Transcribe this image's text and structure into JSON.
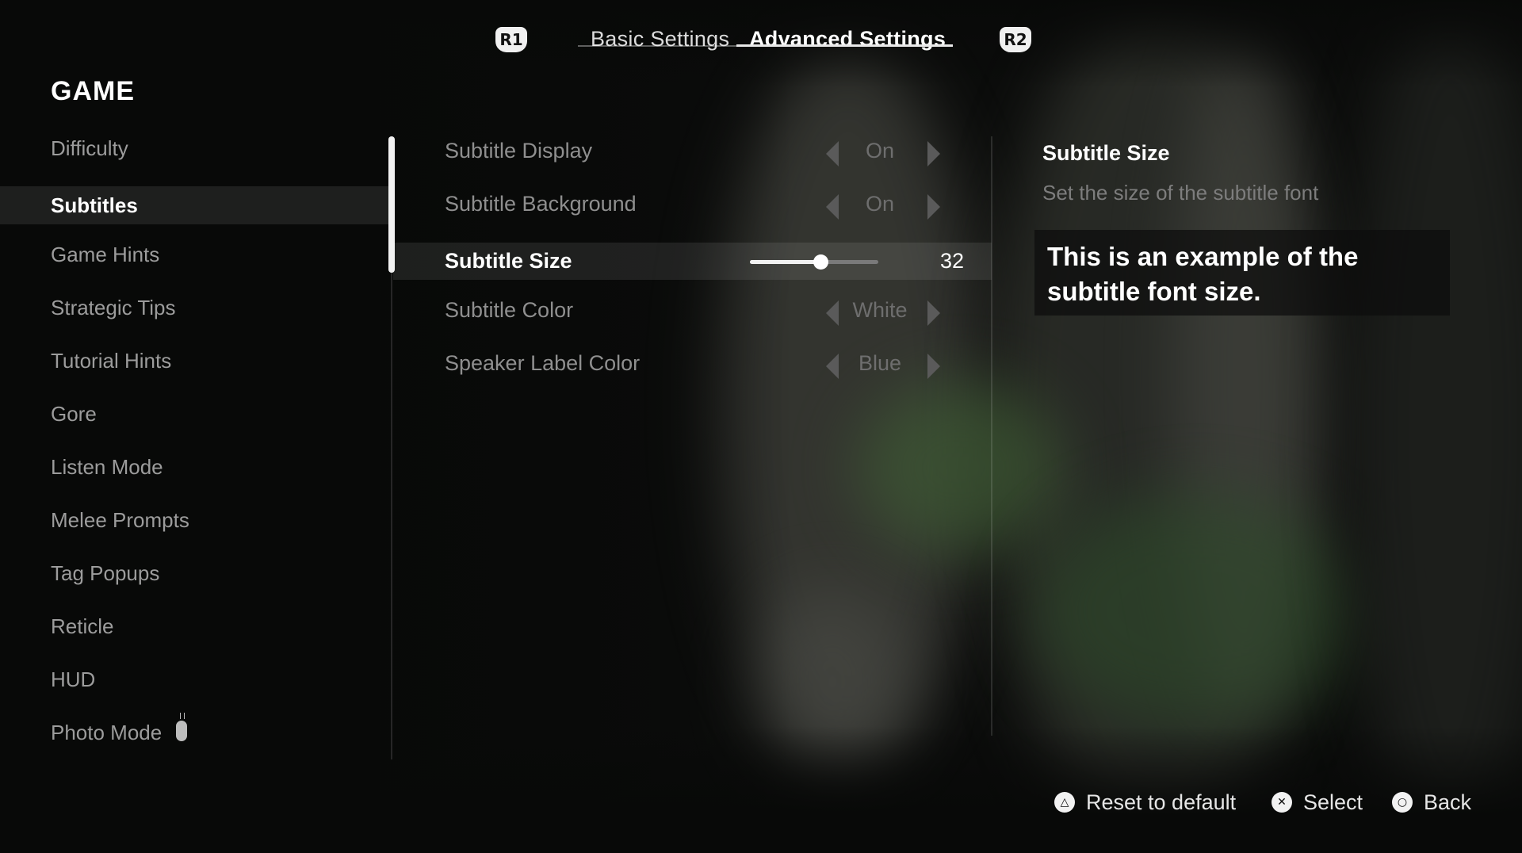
{
  "header": {
    "left_bumper": "R1",
    "right_bumper": "R2",
    "tabs": [
      {
        "label": "Basic Settings",
        "active": false
      },
      {
        "label": "Advanced Settings",
        "active": true
      }
    ]
  },
  "sidebar": {
    "section_title": "GAME",
    "items": [
      {
        "label": "Difficulty"
      },
      {
        "label": "Subtitles",
        "selected": true
      },
      {
        "label": "Game Hints"
      },
      {
        "label": "Strategic Tips"
      },
      {
        "label": "Tutorial Hints"
      },
      {
        "label": "Gore"
      },
      {
        "label": "Listen Mode"
      },
      {
        "label": "Melee Prompts"
      },
      {
        "label": "Tag Popups"
      },
      {
        "label": "Reticle"
      },
      {
        "label": "HUD"
      },
      {
        "label": "Photo Mode",
        "icon": "controller-icon"
      }
    ]
  },
  "settings": [
    {
      "label": "Subtitle Display",
      "type": "selector",
      "value": "On"
    },
    {
      "label": "Subtitle Background",
      "type": "selector",
      "value": "On"
    },
    {
      "label": "Subtitle Size",
      "type": "slider",
      "value": "32",
      "slider_fraction": 0.55,
      "active": true
    },
    {
      "label": "Subtitle Color",
      "type": "selector",
      "value": "White"
    },
    {
      "label": "Speaker Label Color",
      "type": "selector",
      "value": "Blue"
    }
  ],
  "description": {
    "title": "Subtitle Size",
    "text": "Set the size of the subtitle font",
    "preview": "This is an example of the subtitle font size."
  },
  "footer": {
    "prompts": [
      {
        "icon": "triangle-button-icon",
        "glyph": "△",
        "label": "Reset to default"
      },
      {
        "icon": "cross-button-icon",
        "glyph": "✕",
        "label": "Select"
      },
      {
        "icon": "circle-button-icon",
        "glyph": "○",
        "label": "Back"
      }
    ]
  }
}
